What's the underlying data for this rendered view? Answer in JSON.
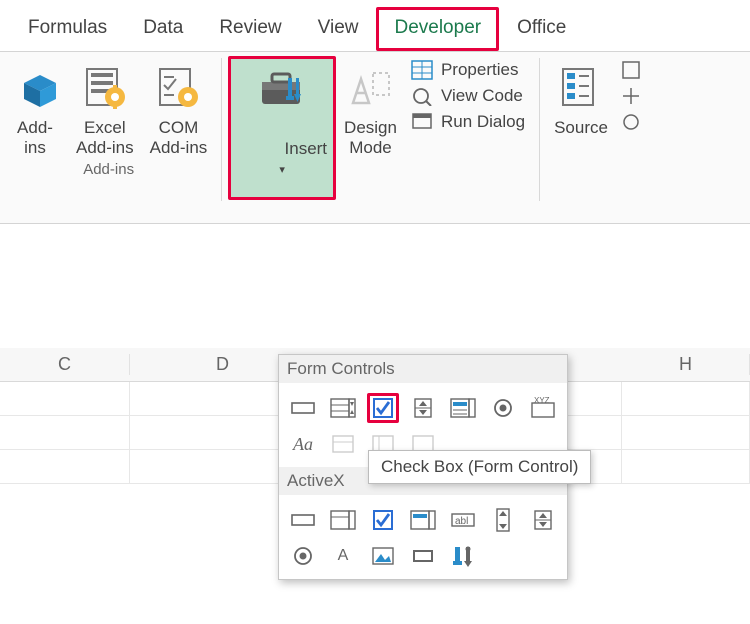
{
  "tabs": {
    "formulas": "Formulas",
    "data": "Data",
    "review": "Review",
    "view": "View",
    "developer": "Developer",
    "office": "Office"
  },
  "ribbon": {
    "addins_btn": "Add-\nins",
    "excel_addins": "Excel\nAdd-ins",
    "com_addins": "COM\nAdd-ins",
    "addins_label": "Add-ins",
    "insert": "Insert",
    "design_mode": "Design\nMode",
    "properties": "Properties",
    "view_code": "View Code",
    "run_dialog": "Run Dialog",
    "source": "Source"
  },
  "dropdown": {
    "form_controls": "Form Controls",
    "activex_controls": "ActiveX"
  },
  "tooltip": "Check Box (Form Control)",
  "columns": {
    "c": "C",
    "d": "D",
    "h": "H"
  }
}
